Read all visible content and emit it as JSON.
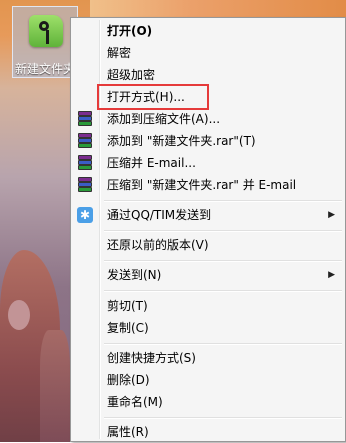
{
  "desktop": {
    "icon_label": "新建文件夹"
  },
  "menu": {
    "items": [
      {
        "label": "打开(O)"
      },
      {
        "label": "解密"
      },
      {
        "label": "超级加密"
      },
      {
        "label": "打开方式(H)..."
      },
      {
        "label": "添加到压缩文件(A)..."
      },
      {
        "label": "添加到 \"新建文件夹.rar\"(T)"
      },
      {
        "label": "压缩并 E-mail..."
      },
      {
        "label": "压缩到 \"新建文件夹.rar\" 并 E-mail"
      },
      {
        "label": "通过QQ/TIM发送到"
      },
      {
        "label": "还原以前的版本(V)"
      },
      {
        "label": "发送到(N)"
      },
      {
        "label": "剪切(T)"
      },
      {
        "label": "复制(C)"
      },
      {
        "label": "创建快捷方式(S)"
      },
      {
        "label": "删除(D)"
      },
      {
        "label": "重命名(M)"
      },
      {
        "label": "属性(R)"
      }
    ],
    "submenu_arrow": "▶"
  },
  "colors": {
    "highlight_box": "#e53a3a",
    "menu_bg": "#f5f5f5"
  },
  "icons": {
    "folder": "folder-key-icon",
    "rar": "winrar-icon",
    "qq": "qq-icon"
  }
}
